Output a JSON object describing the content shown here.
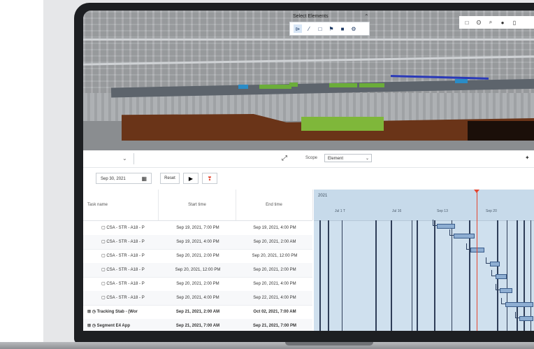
{
  "viewer": {
    "title": "Select Elements",
    "tools": [
      {
        "icon": "select-cursor-icon",
        "glyph": "⊳"
      },
      {
        "icon": "pencil-icon",
        "glyph": "⁄"
      },
      {
        "icon": "box-icon",
        "glyph": "□"
      },
      {
        "icon": "flag-icon",
        "glyph": "⚑"
      },
      {
        "icon": "layers-icon",
        "glyph": "■"
      },
      {
        "icon": "settings-icon",
        "glyph": "⚙"
      }
    ],
    "right_tools": [
      {
        "icon": "window-icon",
        "glyph": "□"
      },
      {
        "icon": "measure-icon",
        "glyph": "ʘ"
      },
      {
        "icon": "search-icon",
        "glyph": "⌕"
      },
      {
        "icon": "paint-icon",
        "glyph": "●"
      },
      {
        "icon": "more-icon",
        "glyph": "▯"
      }
    ]
  },
  "schedule_bar": {
    "scope_label": "Scope",
    "scope_value": "Element"
  },
  "controls": {
    "date_value": "Sep 30, 2021",
    "reset_label": "Reset",
    "play_glyph": "▶",
    "marker_glyph": "❣"
  },
  "gantt": {
    "headers": {
      "task": "Task name",
      "start": "Start time",
      "end": "End time"
    },
    "year_label": "2021",
    "weeks": [
      "Jul 1 T",
      "Jul 16",
      "Sep 13",
      "Sep 20"
    ],
    "rows": [
      {
        "name": "CSA - STR - A18 - P",
        "start": "Sep 19, 2021, 7:00 PM",
        "end": "Sep 19, 2021, 4:00 PM",
        "bold": false
      },
      {
        "name": "CSA - STR - A18 - P",
        "start": "Sep 19, 2021, 4:00 PM",
        "end": "Sep 20, 2021, 2:00 AM",
        "bold": false
      },
      {
        "name": "CSA - STR - A18 - P",
        "start": "Sep 20, 2021, 2:00 PM",
        "end": "Sep 20, 2021, 12:00 PM",
        "bold": false
      },
      {
        "name": "CSA - STR - A18 - P",
        "start": "Sep 20, 2021, 12:00 PM",
        "end": "Sep 20, 2021, 2:00 PM",
        "bold": false
      },
      {
        "name": "CSA - STR - A18 - P",
        "start": "Sep 20, 2021, 2:00 PM",
        "end": "Sep 20, 2021, 4:00 PM",
        "bold": false
      },
      {
        "name": "CSA - STR - A18 - P",
        "start": "Sep 20, 2021, 4:00 PM",
        "end": "Sep 22, 2021, 4:00 PM",
        "bold": false
      },
      {
        "name": "Tracking Stab - (Wor",
        "start": "Sep 21, 2021, 2:00 AM",
        "end": "Oct 02, 2021, 7:00 AM",
        "bold": true
      },
      {
        "name": "Segment E4 App",
        "start": "Sep 21, 2021, 7:00 AM",
        "end": "Sep 21, 2021, 7:00 PM",
        "bold": true
      }
    ]
  },
  "colors": {
    "today_line": "#e4452f",
    "task_bar": "#8eaed2",
    "chart_bg": "#cfe0ee"
  }
}
